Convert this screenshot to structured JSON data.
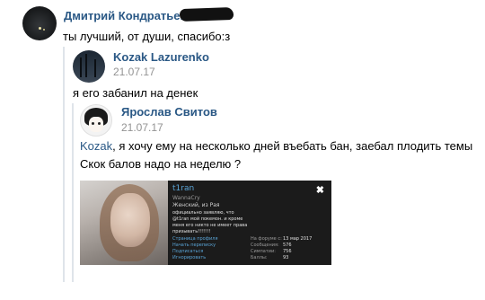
{
  "comments": [
    {
      "author": "Дмитрий Кондратьев",
      "text": "ты лучший, от души, спасибо:з"
    },
    {
      "author": "Kozak Lazurenko",
      "date": "21.07.17",
      "text": "я его забанил на денек"
    },
    {
      "author": "Ярослав Свитов",
      "date": "21.07.17",
      "mention": "Kozak",
      "text_line1": ", я хочу ему на несколько дней въебать бан, заебал плодить темы",
      "text_line2": "Скок балов надо на неделю ?"
    }
  ],
  "profile_card": {
    "username": "t1ran",
    "status": "WannaCry",
    "gender_line": "Женский, из Рая",
    "bio_line1": "официально заявляю, что",
    "bio_line2": "@t1ran мой покемон. и кроме",
    "bio_line3": "меня его никто не имеет права",
    "bio_line4": "призывать!!!!!!!",
    "links": [
      "Страница профиля",
      "Начать переписку",
      "Подписаться",
      "Игнорировать"
    ],
    "stats": [
      {
        "label": "На форуме с:",
        "value": "13 мар 2017"
      },
      {
        "label": "Сообщения:",
        "value": "576"
      },
      {
        "label": "Симпатии:",
        "value": "756"
      },
      {
        "label": "Баллы:",
        "value": "93"
      }
    ],
    "close_symbol": "✖"
  }
}
